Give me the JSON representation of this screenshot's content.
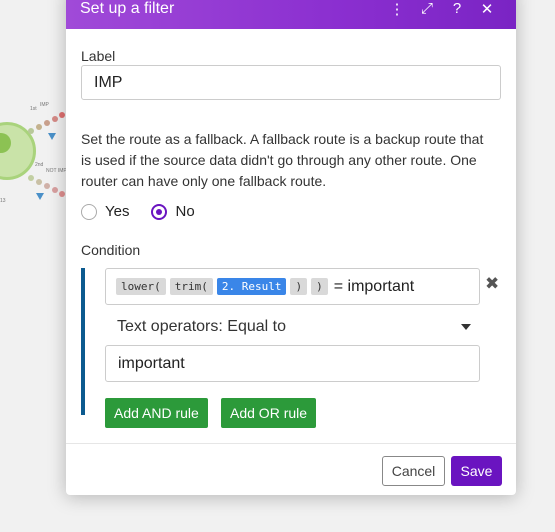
{
  "dialog": {
    "title": "Set up a filter",
    "header_icons": [
      "more-vert-icon",
      "expand-icon",
      "help-icon",
      "close-icon"
    ],
    "header_glyphs": {
      "more": "⋮",
      "expand": "⤢",
      "help": "?",
      "close": "✕"
    }
  },
  "label_field": {
    "label": "Label",
    "value": "IMP"
  },
  "fallback": {
    "text": "Set the route as a fallback. A fallback route is a backup route that is used if the source data didn't go through any other route. One router can have only one fallback route.",
    "options": [
      {
        "label": "Yes",
        "checked": false
      },
      {
        "label": "No",
        "checked": true
      }
    ]
  },
  "condition": {
    "label": "Condition",
    "expression": {
      "pills": [
        "lower(",
        "trim(",
        "2. Result",
        ")",
        ")"
      ],
      "suffix": "= important"
    },
    "operator": "Text operators: Equal to",
    "value": "important",
    "add_and": "Add AND rule",
    "add_or": "Add OR rule",
    "remove_glyph": "✖"
  },
  "footer": {
    "cancel": "Cancel",
    "save": "Save"
  },
  "background": {
    "labels": [
      "1st",
      "IMP",
      "2nd",
      "NOT IMP",
      "13"
    ]
  },
  "colors": {
    "header_start": "#a04ad8",
    "header_end": "#7a24c4",
    "primary": "#6a14c0",
    "green": "#2c9a3a",
    "condition_bar": "#0c5a8f",
    "pill_blue": "#3a86e8"
  }
}
